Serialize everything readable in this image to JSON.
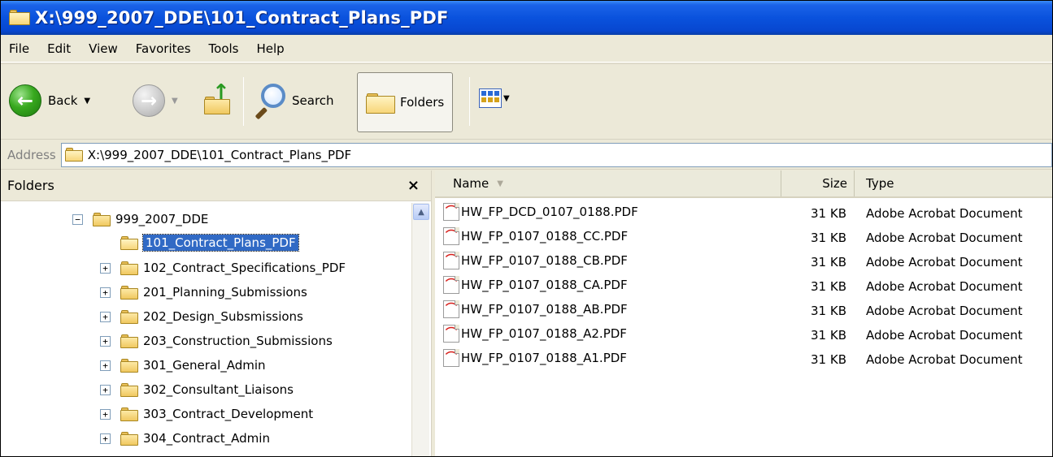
{
  "window": {
    "title": "X:\\999_2007_DDE\\101_Contract_Plans_PDF"
  },
  "menu": [
    "File",
    "Edit",
    "View",
    "Favorites",
    "Tools",
    "Help"
  ],
  "toolbar": {
    "back_label": "Back",
    "search_label": "Search",
    "folders_label": "Folders",
    "icons": {
      "back": "back-arrow-icon",
      "forward": "forward-arrow-icon",
      "up": "up-folder-icon",
      "search": "magnifier-icon",
      "folders": "folders-icon",
      "views": "views-icon"
    }
  },
  "address": {
    "label": "Address",
    "value": "X:\\999_2007_DDE\\101_Contract_Plans_PDF"
  },
  "folders_pane": {
    "title": "Folders",
    "close": "×",
    "tree": [
      {
        "label": "999_2007_DDE",
        "toggle": "−",
        "level": 0
      },
      {
        "label": "101_Contract_Plans_PDF",
        "toggle": "",
        "level": 1,
        "selected": true
      },
      {
        "label": "102_Contract_Specifications_PDF",
        "toggle": "+",
        "level": 1
      },
      {
        "label": "201_Planning_Submissions",
        "toggle": "+",
        "level": 1
      },
      {
        "label": "202_Design_Subsmissions",
        "toggle": "+",
        "level": 1
      },
      {
        "label": "203_Construction_Submissions",
        "toggle": "+",
        "level": 1
      },
      {
        "label": "301_General_Admin",
        "toggle": "+",
        "level": 1
      },
      {
        "label": "302_Consultant_Liaisons",
        "toggle": "+",
        "level": 1
      },
      {
        "label": "303_Contract_Development",
        "toggle": "+",
        "level": 1
      },
      {
        "label": "304_Contract_Admin",
        "toggle": "+",
        "level": 1
      }
    ]
  },
  "file_list": {
    "columns": {
      "name": "Name",
      "size": "Size",
      "type": "Type"
    },
    "files": [
      {
        "name": "HW_FP_DCD_0107_0188.PDF",
        "size": "31 KB",
        "type": "Adobe Acrobat Document"
      },
      {
        "name": "HW_FP_0107_0188_CC.PDF",
        "size": "31 KB",
        "type": "Adobe Acrobat Document"
      },
      {
        "name": "HW_FP_0107_0188_CB.PDF",
        "size": "31 KB",
        "type": "Adobe Acrobat Document"
      },
      {
        "name": "HW_FP_0107_0188_CA.PDF",
        "size": "31 KB",
        "type": "Adobe Acrobat Document"
      },
      {
        "name": "HW_FP_0107_0188_AB.PDF",
        "size": "31 KB",
        "type": "Adobe Acrobat Document"
      },
      {
        "name": "HW_FP_0107_0188_A2.PDF",
        "size": "31 KB",
        "type": "Adobe Acrobat Document"
      },
      {
        "name": "HW_FP_0107_0188_A1.PDF",
        "size": "31 KB",
        "type": "Adobe Acrobat Document"
      }
    ]
  },
  "colors": {
    "title_bar": "#0a52dd",
    "selection": "#316ac5",
    "chrome": "#ece9d8"
  }
}
